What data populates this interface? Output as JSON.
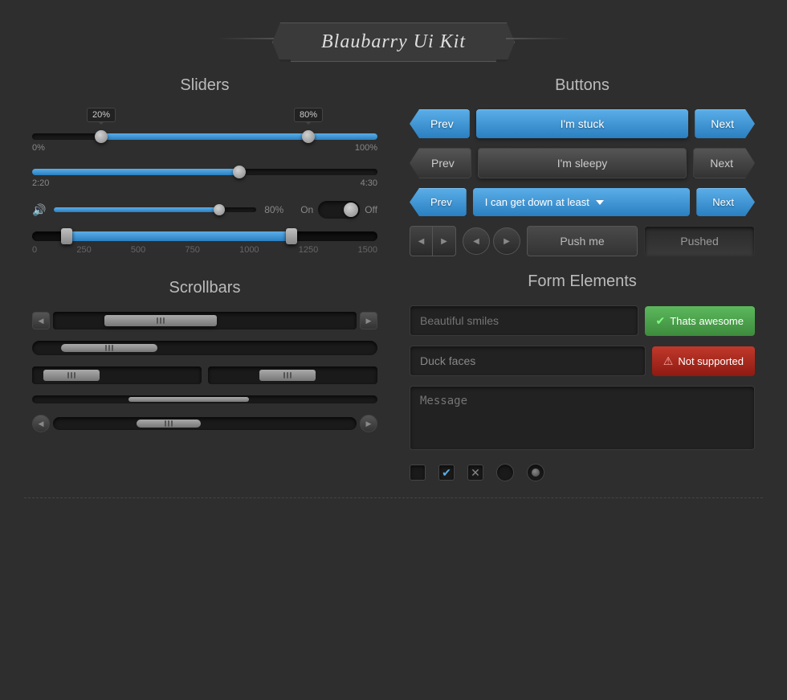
{
  "banner": {
    "title": "Blaubarry Ui Kit"
  },
  "sliders": {
    "section_title": "Sliders",
    "slider1": {
      "min_label": "0%",
      "max_label": "100%",
      "tooltip1": "20%",
      "tooltip2": "80%",
      "fill_pct": 80,
      "thumb1_pct": 20,
      "thumb2_pct": 80
    },
    "slider2": {
      "min_label": "2:20",
      "max_label": "4:30",
      "thumb_pct": 60
    },
    "volume": {
      "pct_label": "80%",
      "on_label": "On",
      "off_label": "Off"
    },
    "range": {
      "labels": [
        "0",
        "250",
        "500",
        "750",
        "1000",
        "1250",
        "1500"
      ]
    }
  },
  "scrollbars": {
    "section_title": "Scrollbars"
  },
  "buttons": {
    "section_title": "Buttons",
    "row1": {
      "prev": "Prev",
      "stuck": "I'm stuck",
      "next": "Next"
    },
    "row2": {
      "prev": "Prev",
      "sleepy": "I'm sleepy",
      "next": "Next"
    },
    "row3": {
      "prev": "Prev",
      "dropdown": "I can get down at least",
      "next": "Next"
    },
    "row4": {
      "push_me": "Push me",
      "pushed": "Pushed"
    }
  },
  "form": {
    "section_title": "Form Elements",
    "input1": {
      "placeholder": "Beautiful smiles"
    },
    "input2": {
      "value": "Duck faces"
    },
    "btn_green": "Thats awesome",
    "btn_red": "Not supported",
    "textarea_placeholder": "Message"
  }
}
